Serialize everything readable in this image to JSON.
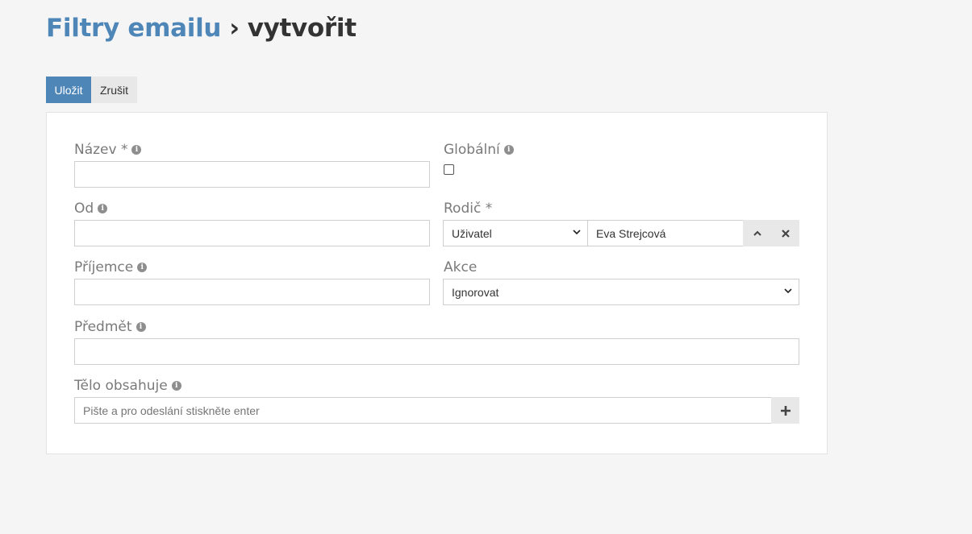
{
  "breadcrumb": {
    "parent": "Filtry emailu",
    "separator": "›",
    "current": "vytvořit"
  },
  "actions": {
    "save": "Uložit",
    "cancel": "Zrušit"
  },
  "form": {
    "name": {
      "label": "Název *",
      "value": ""
    },
    "global": {
      "label": "Globální",
      "checked": false
    },
    "from": {
      "label": "Od",
      "value": ""
    },
    "parent": {
      "label": "Rodič *",
      "type_value": "Uživatel",
      "entity_value": "Eva Strejcová"
    },
    "recipient": {
      "label": "Příjemce",
      "value": ""
    },
    "action": {
      "label": "Akce",
      "value": "Ignorovat"
    },
    "subject": {
      "label": "Předmět",
      "value": ""
    },
    "body": {
      "label": "Tělo obsahuje",
      "placeholder": "Pište a pro odeslání stiskněte enter"
    }
  },
  "icons": {
    "info": "info-icon",
    "caret": "chevron-down-icon",
    "up": "chevron-up-icon",
    "clear": "close-icon",
    "add": "plus-icon"
  },
  "colors": {
    "accent": "#4f86b8",
    "background": "#f5f5f5"
  }
}
